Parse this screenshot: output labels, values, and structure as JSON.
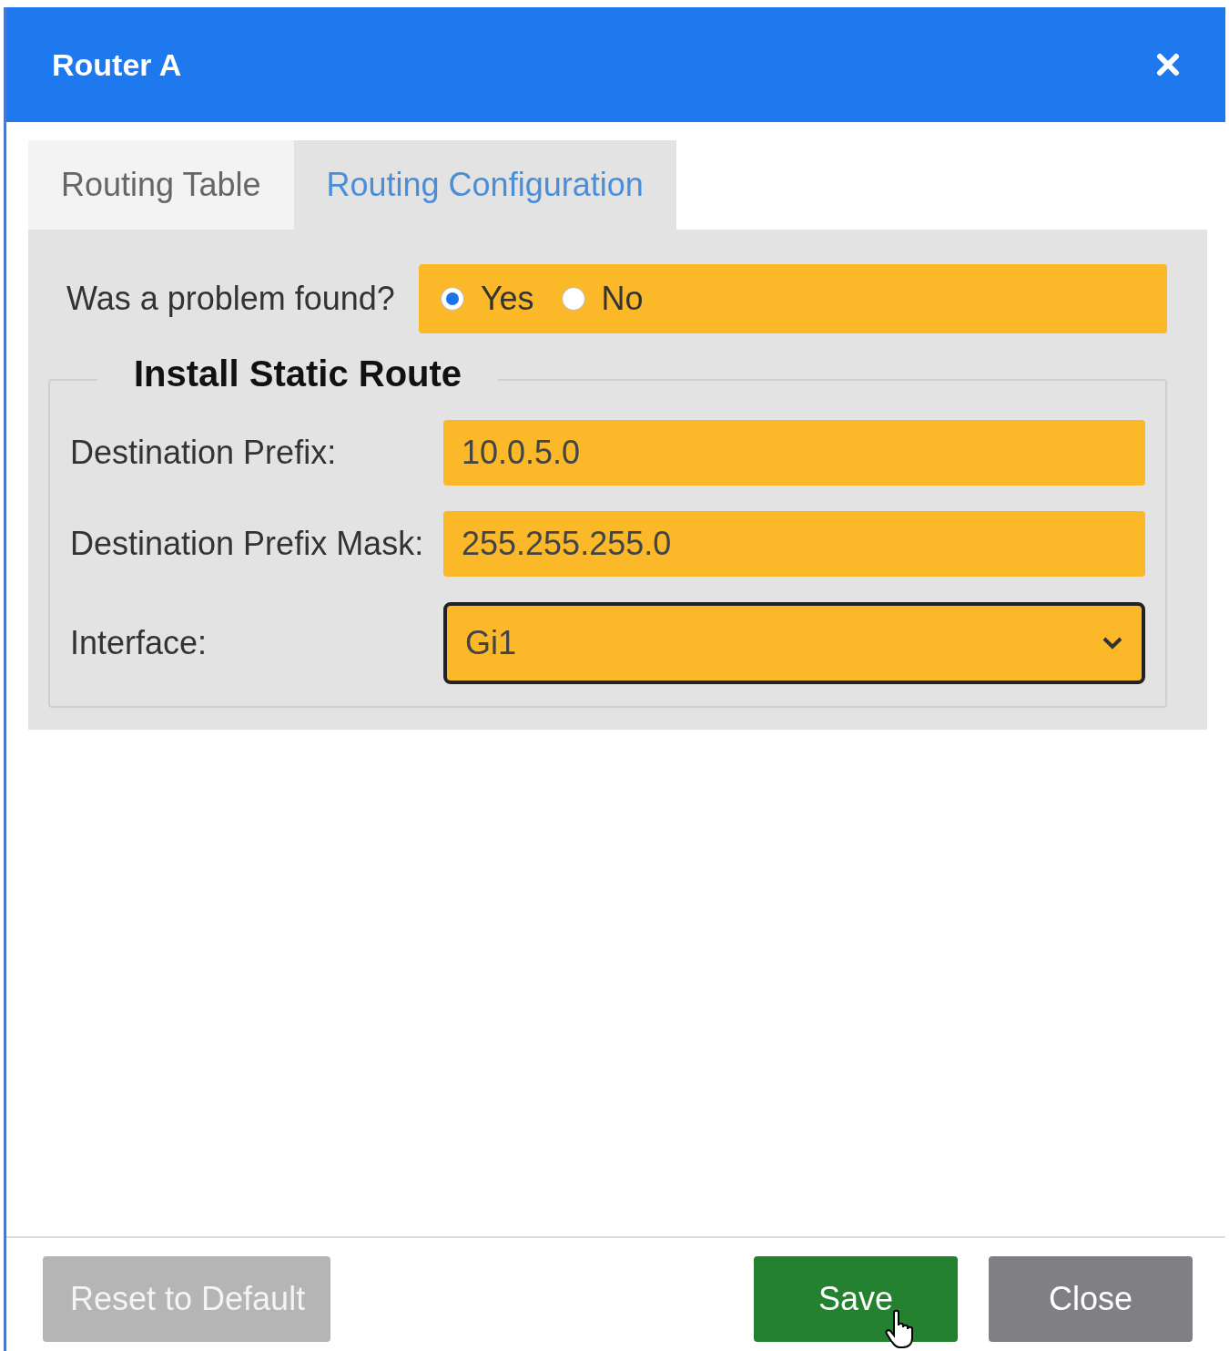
{
  "window": {
    "title": "Router A"
  },
  "tabs": [
    {
      "label": "Routing Table",
      "selected": false
    },
    {
      "label": "Routing Configuration",
      "selected": true
    }
  ],
  "question": {
    "label": "Was a problem found?",
    "options": [
      {
        "label": "Yes",
        "selected": true
      },
      {
        "label": "No",
        "selected": false
      }
    ]
  },
  "section": {
    "title": "Install Static Route",
    "fields": [
      {
        "kind": "text",
        "label": "Destination Prefix:",
        "value": "10.0.5.0"
      },
      {
        "kind": "text",
        "label": "Destination Prefix Mask:",
        "value": "255.255.255.0"
      },
      {
        "kind": "select",
        "label": "Interface:",
        "value": "Gi1"
      }
    ]
  },
  "buttons": [
    {
      "kind": "reset",
      "label": "Reset to Default",
      "disabled": true
    },
    {
      "kind": "save",
      "label": "Save",
      "disabled": false
    },
    {
      "kind": "close",
      "label": "Close",
      "disabled": false
    }
  ]
}
